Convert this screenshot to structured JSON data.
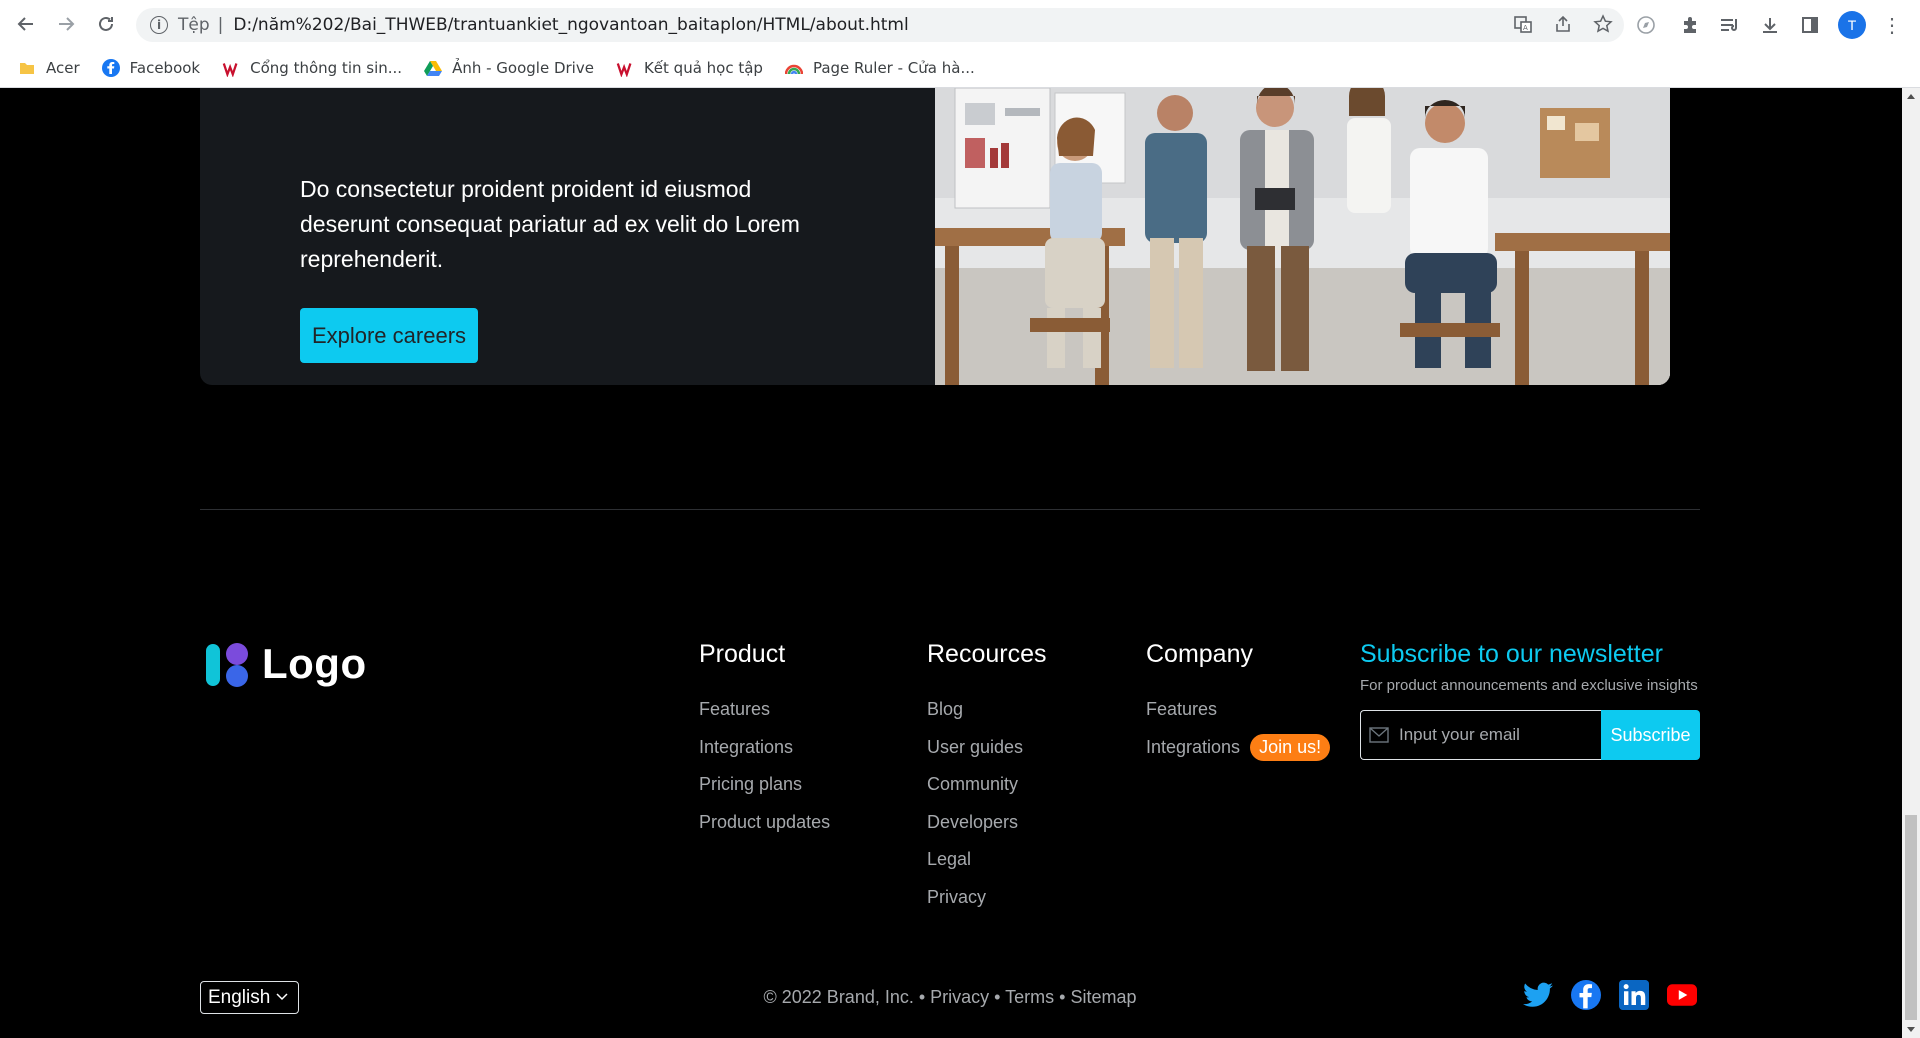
{
  "browser": {
    "scheme_label": "Tệp",
    "url": "D:/năm%202/Bai_THWEB/trantuankiet_ngovantoan_baitaplon/HTML/about.html",
    "profile_initial": "T",
    "bookmarks": [
      {
        "label": "Acer",
        "icon": "folder-icon"
      },
      {
        "label": "Facebook",
        "icon": "facebook-icon"
      },
      {
        "label": "Cổng thông tin sin...",
        "icon": "vnu-icon"
      },
      {
        "label": "Ảnh - Google Drive",
        "icon": "google-drive-icon"
      },
      {
        "label": "Kết quả học tập",
        "icon": "vnu-icon"
      },
      {
        "label": "Page Ruler - Cửa hà...",
        "icon": "rainbow-icon"
      }
    ]
  },
  "hero": {
    "text": "Do consectetur proident proident id eiusmod deserunt consequat pariatur ad ex velit do Lorem reprehenderit.",
    "button_label": "Explore careers"
  },
  "footer": {
    "logo_text": "Logo",
    "columns": [
      {
        "title": "Product",
        "links": [
          "Features",
          "Integrations",
          "Pricing plans",
          "Product updates"
        ]
      },
      {
        "title": "Recources",
        "links": [
          "Blog",
          "User guides",
          "Community",
          "Developers",
          "Legal",
          "Privacy"
        ]
      },
      {
        "title": "Company",
        "links": [
          "Features",
          "Integrations"
        ],
        "badge": "Join us!"
      }
    ],
    "newsletter": {
      "title": "Subscribe to our newsletter",
      "subtitle": "For product announcements and exclusive insights",
      "placeholder": "Input your email",
      "button_label": "Subscribe"
    },
    "language": "English",
    "copyright": "© 2022 Brand, Inc. • Privacy • Terms • Sitemap",
    "social": [
      "twitter-icon",
      "facebook-icon",
      "linkedin-icon",
      "youtube-icon"
    ]
  },
  "colors": {
    "accent": "#0dcaf0",
    "badge": "#fd7e14",
    "background": "#000000",
    "card": "#16191d"
  }
}
